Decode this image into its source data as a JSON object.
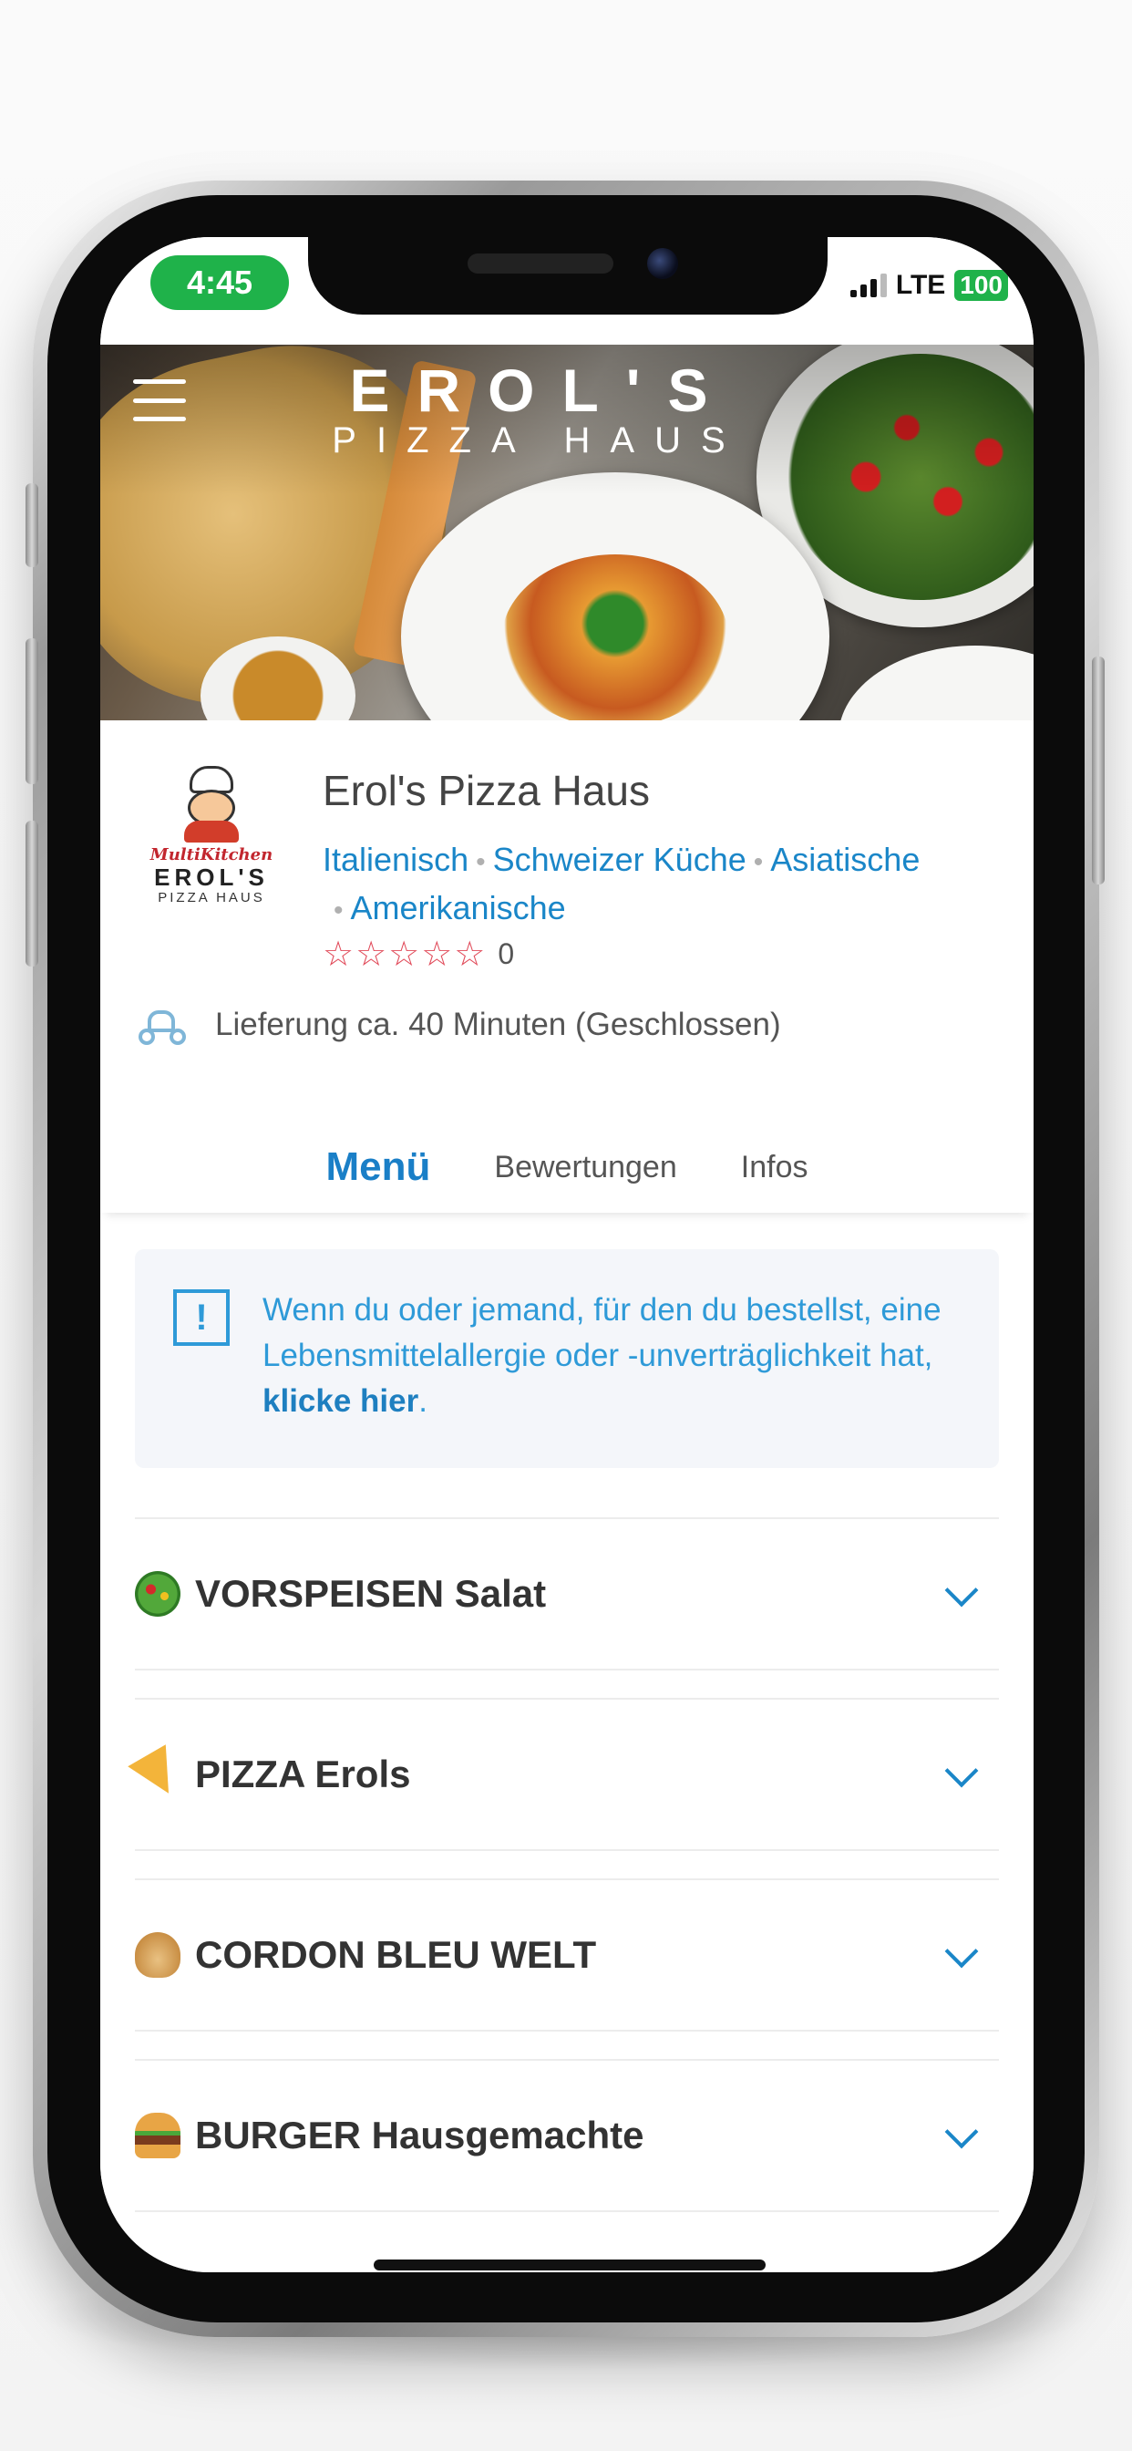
{
  "status_bar": {
    "time": "4:45",
    "network": "LTE",
    "battery": "100"
  },
  "header": {
    "menu_icon": "hamburger-icon",
    "logo_title": "EROL'S",
    "logo_subtitle": "PIZZA HAUS"
  },
  "restaurant": {
    "logo": {
      "line1": "MultiKitchen",
      "line2": "EROL'S",
      "line3": "PIZZA HAUS"
    },
    "name": "Erol's Pizza Haus",
    "cuisines": [
      "Italienisch",
      "Schweizer Küche",
      "Asiatische",
      "Amerikanische"
    ],
    "rating_stars": "☆☆☆☆☆",
    "rating_count": "0",
    "delivery": "Lieferung ca. 40 Minuten (Geschlossen)"
  },
  "tabs": [
    {
      "label": "Menü",
      "active": true
    },
    {
      "label": "Bewertungen",
      "active": false
    },
    {
      "label": "Infos",
      "active": false
    }
  ],
  "allergy": {
    "icon": "!",
    "text": "Wenn du oder jemand, für den du bestellst, eine Lebensmittelallergie oder -unverträglichkeit hat, ",
    "link": "klicke hier",
    "end": "."
  },
  "categories": [
    {
      "emoji": "salad-emoji",
      "title": "VORSPEISEN Salat"
    },
    {
      "emoji": "pizza-emoji",
      "title": "PIZZA Erols"
    },
    {
      "emoji": "dumpling-emoji",
      "title": "CORDON BLEU WELT"
    },
    {
      "emoji": "burger-emoji",
      "title": "BURGER Hausgemachte"
    }
  ],
  "colors": {
    "accent": "#1a86c8",
    "status_green": "#1fb24a",
    "star_red": "#e14b5a"
  }
}
